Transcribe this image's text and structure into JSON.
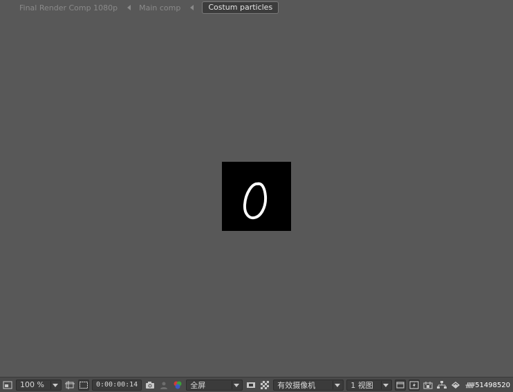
{
  "breadcrumb": {
    "items": [
      {
        "label": "Final Render Comp 1080p"
      },
      {
        "label": "Main comp"
      },
      {
        "label": "Costum particles"
      }
    ]
  },
  "viewer": {
    "comp_glyph": "0",
    "background_color": "#585858",
    "comp_color": "#000000"
  },
  "toolbar": {
    "magnification": "100 %",
    "timecode": "0:00:00:14",
    "resolution": "全屏",
    "camera": "有效摄像机",
    "views": "1 视图",
    "icons": [
      "always-preview-icon",
      "region-of-interest-icon",
      "transparency-grid-icon",
      "snapshot-icon",
      "show-snapshot-icon",
      "color-channels-icon",
      "toggle-mask-icon",
      "checkerboard-icon",
      "pixel-aspect-icon",
      "fast-preview-icon",
      "timeline-icon",
      "flowchart-icon",
      "exposure-icon"
    ]
  },
  "watermark": {
    "text": "51498520"
  }
}
